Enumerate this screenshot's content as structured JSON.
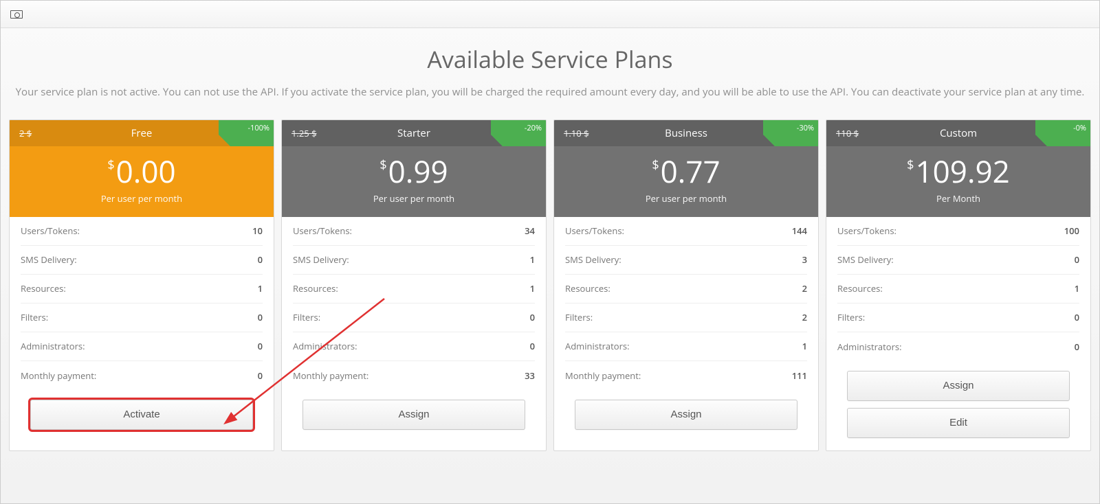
{
  "header": {
    "title": "Available Service Plans",
    "description": "Your service plan is not active. You can not use the API. If you activate the service plan, you will be charged the required amount every day, and you will be able to use the API. You can deactivate your service plan at any time."
  },
  "feature_labels": {
    "users": "Users/Tokens:",
    "sms": "SMS Delivery:",
    "resources": "Resources:",
    "filters": "Filters:",
    "admins": "Administrators:",
    "monthly": "Monthly payment:"
  },
  "buttons": {
    "activate": "Activate",
    "assign": "Assign",
    "edit": "Edit"
  },
  "plans": {
    "free": {
      "name": "Free",
      "old_price": "2 $",
      "discount": "-100%",
      "currency": "$",
      "price": "0.00",
      "period": "Per user per month",
      "features": {
        "users": "10",
        "sms": "0",
        "resources": "1",
        "filters": "0",
        "admins": "0",
        "monthly": "0"
      }
    },
    "starter": {
      "name": "Starter",
      "old_price": "1.25 $",
      "discount": "-20%",
      "currency": "$",
      "price": "0.99",
      "period": "Per user per month",
      "features": {
        "users": "34",
        "sms": "1",
        "resources": "1",
        "filters": "0",
        "admins": "0",
        "monthly": "33"
      }
    },
    "business": {
      "name": "Business",
      "old_price": "1.10 $",
      "discount": "-30%",
      "currency": "$",
      "price": "0.77",
      "period": "Per user per month",
      "features": {
        "users": "144",
        "sms": "3",
        "resources": "2",
        "filters": "2",
        "admins": "1",
        "monthly": "111"
      }
    },
    "custom": {
      "name": "Custom",
      "old_price": "110 $",
      "discount": "-0%",
      "currency": "$",
      "price": "109.92",
      "period": "Per Month",
      "features": {
        "users": "100",
        "sms": "0",
        "resources": "1",
        "filters": "0",
        "admins": "0"
      }
    }
  }
}
